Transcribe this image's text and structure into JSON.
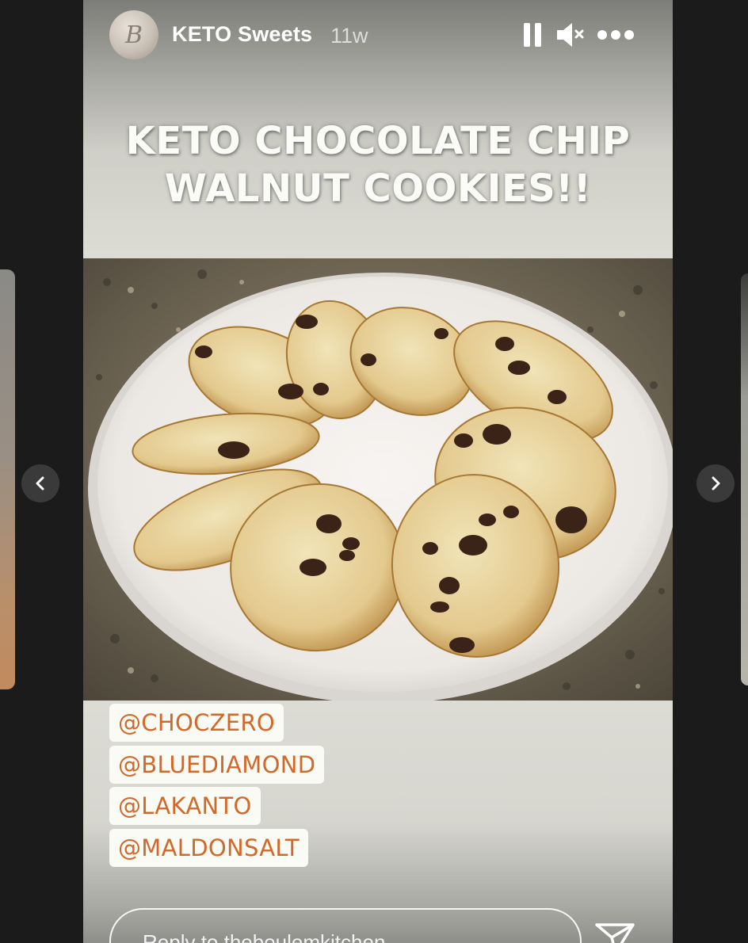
{
  "story": {
    "username": "KETO Sweets",
    "timestamp": "11w",
    "title_line1": "KETO CHOCOLATE CHIP",
    "title_line2": "WALNUT COOKIES!!",
    "avatar_letter": "B",
    "tags": [
      "@CHOCZERO",
      "@BLUEDIAMOND",
      "@LAKANTO",
      "@MALDONSALT"
    ],
    "reply_placeholder": "Reply to theboulemkitchen..."
  },
  "controls": {
    "pause_icon": "pause-icon",
    "mute_icon": "muted-speaker-icon",
    "more_icon": "more-options-icon",
    "send_icon": "paper-plane-icon",
    "prev_icon": "chevron-left-icon",
    "next_icon": "chevron-right-icon"
  },
  "colors": {
    "background": "#1b1b1b",
    "tag_text": "#d2682a",
    "tag_background": "#fbfbf6",
    "title_text": "#fbfbf7"
  }
}
